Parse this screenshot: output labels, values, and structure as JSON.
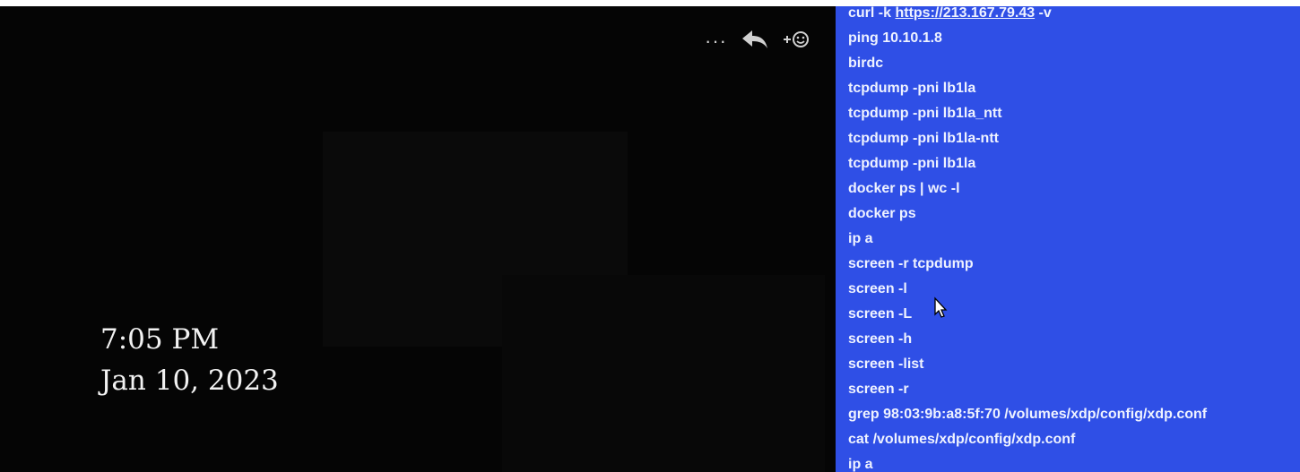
{
  "timestamp": {
    "time": "7:05 PM",
    "date": "Jan 10, 2023"
  },
  "message_actions": [
    {
      "icon": "more-icon",
      "label": "···"
    },
    {
      "icon": "reply-icon"
    },
    {
      "icon": "add-reaction-icon"
    }
  ],
  "terminal": {
    "history": [
      {
        "pre": "curl -k ",
        "link": "https://213.167.79.43",
        "post": " -v"
      },
      {
        "pre": "ping 10.10.1.8"
      },
      {
        "pre": "birdc"
      },
      {
        "pre": "tcpdump -pni lb1la"
      },
      {
        "pre": "tcpdump -pni lb1la_ntt"
      },
      {
        "pre": "tcpdump -pni lb1la-ntt"
      },
      {
        "pre": "tcpdump -pni lb1la"
      },
      {
        "pre": "docker ps | wc -l"
      },
      {
        "pre": "docker ps"
      },
      {
        "pre": "ip a"
      },
      {
        "pre": "screen -r tcpdump"
      },
      {
        "pre": "screen -l"
      },
      {
        "pre": "screen -L"
      },
      {
        "pre": "screen -h"
      },
      {
        "pre": "screen -list"
      },
      {
        "pre": "screen -r"
      },
      {
        "pre": "grep 98:03:9b:a8:5f:70 /volumes/xdp/config/xdp.conf"
      },
      {
        "pre": "cat /volumes/xdp/config/xdp.conf"
      },
      {
        "pre": "ip a"
      }
    ]
  },
  "colors": {
    "terminal_bg": "#2f4fe6",
    "terminal_text": "#eef2ff",
    "left_bg": "#050505"
  }
}
